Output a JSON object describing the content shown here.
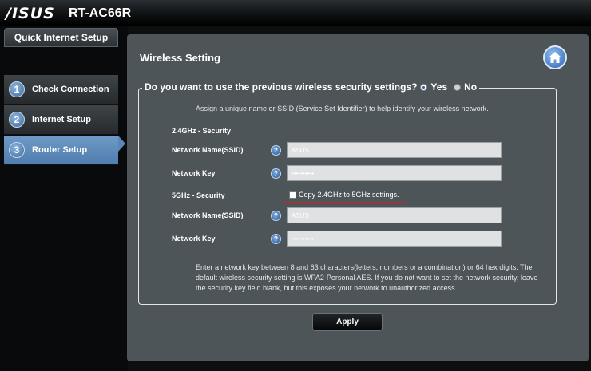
{
  "header": {
    "brand": "/ISUS",
    "model": "RT-AC66R"
  },
  "sidebar": {
    "title": "Quick Internet Setup",
    "steps": [
      {
        "num": "1",
        "label": "Check Connection",
        "active": false
      },
      {
        "num": "2",
        "label": "Internet Setup",
        "active": false
      },
      {
        "num": "3",
        "label": "Router Setup",
        "active": true
      }
    ]
  },
  "main": {
    "title": "Wireless Setting",
    "home_icon": "home-icon",
    "question": "Do you want to use the previous wireless security settings?",
    "yes_label": "Yes",
    "no_label": "No",
    "selected": "Yes",
    "hint": "Assign a unique name or SSID (Service Set Identifier) to help identify your wireless network.",
    "band_24": {
      "title": "2.4GHz - Security",
      "ssid_label": "Network Name(SSID)",
      "ssid_value": "ASUS",
      "key_label": "Network Key",
      "key_value": "••••••••••"
    },
    "band_5": {
      "title": "5GHz - Security",
      "copy_label": "Copy 2.4GHz to 5GHz settings.",
      "copy_checked": false,
      "ssid_label": "Network Name(SSID)",
      "ssid_value": "ASUS",
      "key_label": "Network Key",
      "key_value": "••••••••••"
    },
    "note_lines": [
      "Enter a network key between 8 and 63 characters(letters, numbers or a combination) or 64 hex digits. The",
      "default wireless security setting is WPA2-Personal AES. If you do not want to set the network security, leave",
      "the security key field blank, but this exposes your network to unauthorized access."
    ],
    "apply_label": "Apply"
  },
  "colors": {
    "accent_blue": "#4f7dae",
    "panel_bg": "#4d5559",
    "annotation_red": "#d41d1d"
  }
}
